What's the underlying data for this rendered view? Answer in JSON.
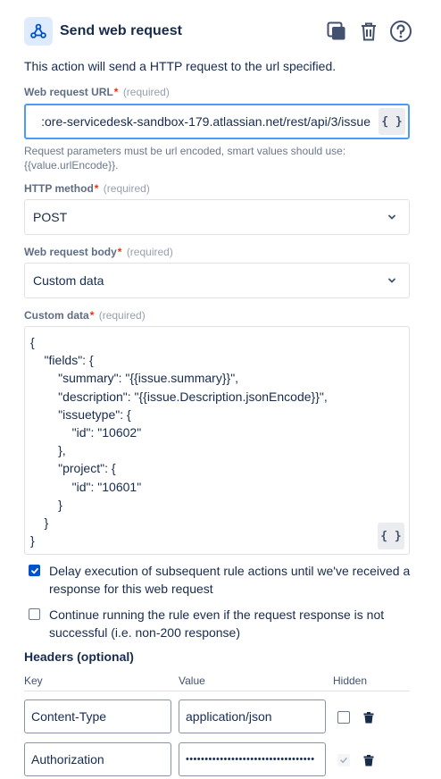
{
  "header": {
    "title": "Send web request"
  },
  "description": "This action will send a HTTP request to the url specified.",
  "url_field": {
    "label": "Web request URL",
    "required_mark": "*",
    "required_text": "(required)",
    "value": ":ore-servicedesk-sandbox-179.atlassian.net/rest/api/3/issue",
    "smart_button": "{ }",
    "helper": "Request parameters must be url encoded, smart values should use: {{value.urlEncode}}."
  },
  "method_field": {
    "label": "HTTP method",
    "required_mark": "*",
    "required_text": "(required)",
    "value": "POST"
  },
  "body_field": {
    "label": "Web request body",
    "required_mark": "*",
    "required_text": "(required)",
    "value": "Custom data"
  },
  "custom_data": {
    "label": "Custom data",
    "required_mark": "*",
    "required_text": "(required)",
    "code": "{\n    \"fields\": {\n        \"summary\": \"{{issue.summary}}\",\n        \"description\": \"{{issue.Description.jsonEncode}}\",\n        \"issuetype\": {\n            \"id\": \"10602\"\n        },\n        \"project\": {\n            \"id\": \"10601\"\n        }\n    }\n}",
    "smart_button": "{ }"
  },
  "options": {
    "delay": {
      "checked": true,
      "text": "Delay execution of subsequent rule actions until we've received a response for this web request"
    },
    "continue": {
      "checked": false,
      "text": "Continue running the rule even if the request response is not successful (i.e. non-200 response)"
    }
  },
  "headers": {
    "title": "Headers (optional)",
    "columns": {
      "key": "Key",
      "value": "Value",
      "hidden": "Hidden"
    },
    "rows": [
      {
        "key": "Content-Type",
        "value": "application/json",
        "hidden": false
      },
      {
        "key": "Authorization",
        "value": "••••••••••••••••••••••••••••••••••",
        "hidden": true
      }
    ]
  },
  "colors": {
    "accent": "#0052CC",
    "focus_border": "#4C9AFF",
    "required": "#DE350B",
    "icon_bg": "#DEEBFF"
  },
  "icons": {
    "app": "webhook-icon",
    "duplicate": "duplicate-icon",
    "delete": "trash-icon",
    "help": "help-icon"
  }
}
